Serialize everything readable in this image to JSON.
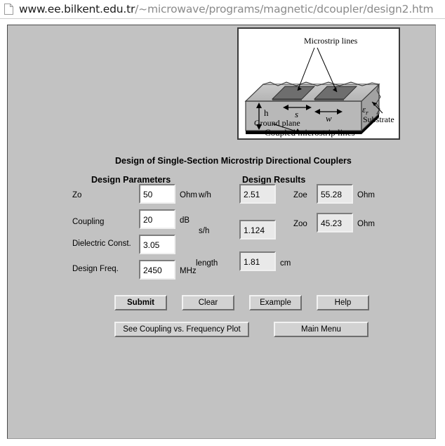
{
  "browser": {
    "icon": "page-icon",
    "url_strong": "www.ee.bilkent.edu.tr",
    "url_dim": "/~microwave/programs/magnetic/dcoupler/design2.htm"
  },
  "diagram": {
    "labels": {
      "microstrip_lines": "Microstrip lines",
      "ground_plane": "Ground plane",
      "substrate": "Substrate",
      "h": "h",
      "s": "s",
      "w": "w",
      "epsilon_r": "ε",
      "epsilon_sub": "r"
    },
    "caption": "Coupled microstrip lines"
  },
  "form": {
    "title": "Design of Single-Section Microstrip Directional Couplers",
    "parameters_heading": "Design  Parameters",
    "results_heading": "Design  Results",
    "parameters": [
      {
        "label": "Zo",
        "value": "50",
        "unit": "Ohm"
      },
      {
        "label": "Coupling",
        "value": "20",
        "unit": "dB"
      },
      {
        "label": "Dielectric Const.",
        "value": "3.05",
        "unit": ""
      },
      {
        "label": "Design Freq.",
        "value": "2450",
        "unit": "MHz"
      }
    ],
    "results_left": [
      {
        "label": "w/h",
        "value": "2.51",
        "unit": ""
      },
      {
        "label": "s/h",
        "value": "1.124",
        "unit": ""
      },
      {
        "label": "length",
        "value": "1.81",
        "unit": "cm"
      }
    ],
    "results_right": [
      {
        "label": "Zoe",
        "value": "55.28",
        "unit": "Ohm"
      },
      {
        "label": "Zoo",
        "value": "45.23",
        "unit": "Ohm"
      }
    ]
  },
  "buttons": {
    "submit": "Submit",
    "clear": "Clear",
    "example": "Example",
    "help": "Help",
    "plot": "See Coupling vs. Frequency Plot",
    "main_menu": "Main Menu"
  },
  "colors": {
    "page_bg": "#c2c2c2",
    "field_bg": "#ffffff",
    "readonly_field_bg": "#e9e9e9",
    "button_bg": "#d2d2d2",
    "text": "#000000"
  }
}
